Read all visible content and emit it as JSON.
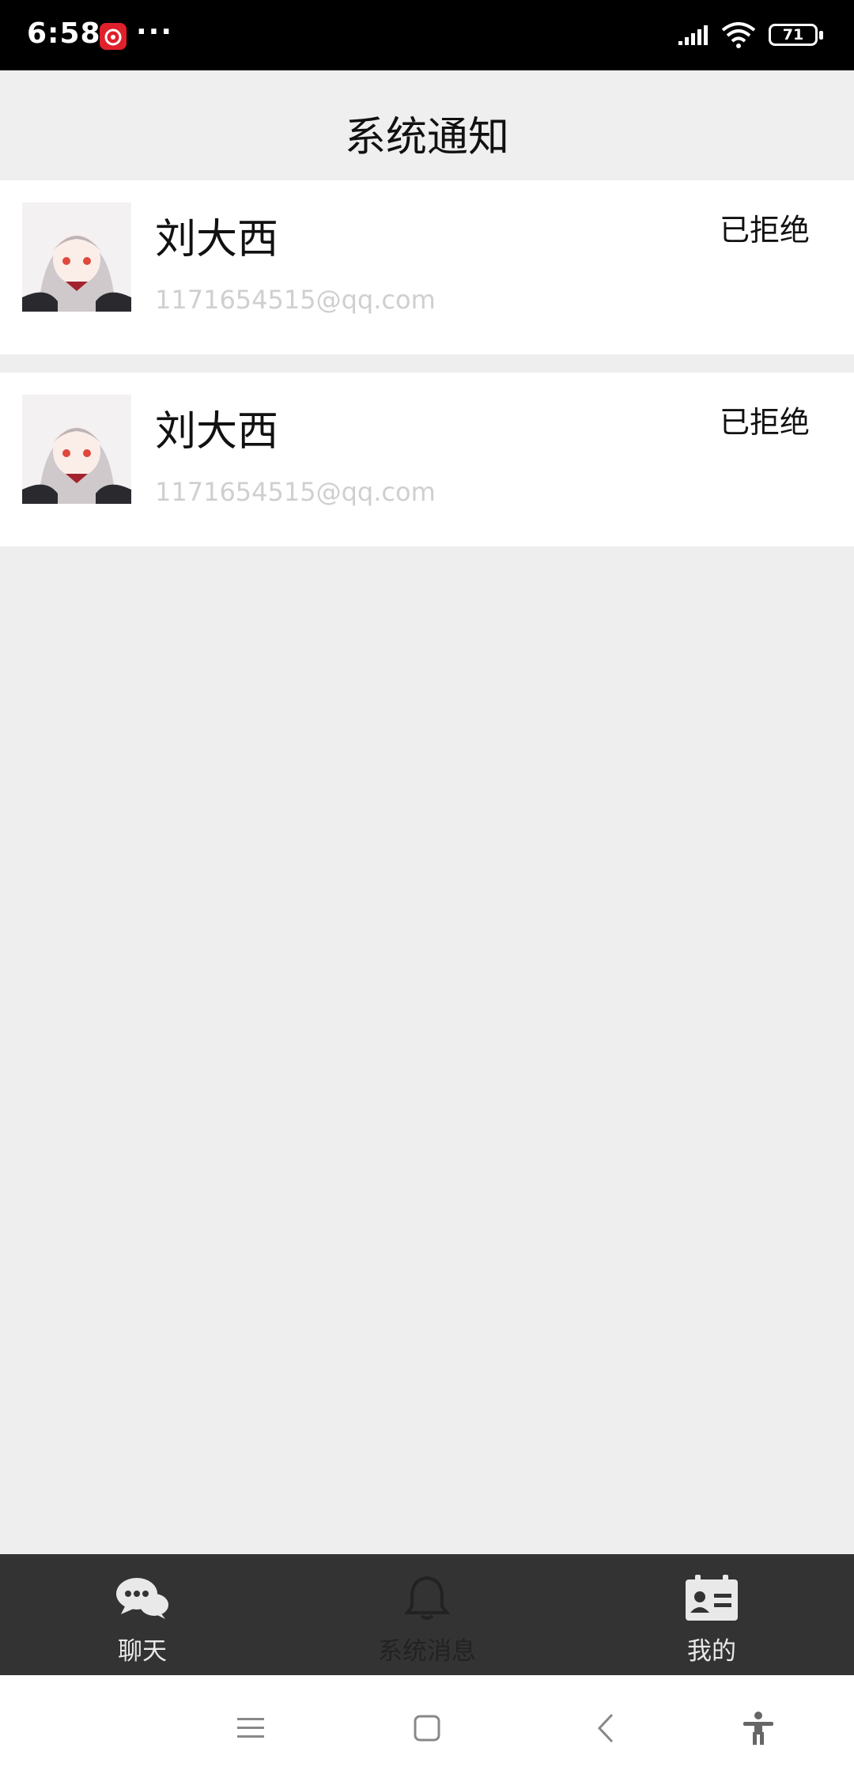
{
  "status_bar": {
    "time": "6:58",
    "more": "···",
    "battery": "71"
  },
  "header": {
    "title": "系统通知"
  },
  "notifications": [
    {
      "name": "刘大西",
      "email": "1171654515@qq.com",
      "status": "已拒绝"
    },
    {
      "name": "刘大西",
      "email": "1171654515@qq.com",
      "status": "已拒绝"
    }
  ],
  "tabbar": {
    "tabs": [
      {
        "label": "聊天",
        "icon": "chat-icon"
      },
      {
        "label": "系统消息",
        "icon": "bell-icon"
      },
      {
        "label": "我的",
        "icon": "contact-card-icon"
      }
    ]
  },
  "navbar": {
    "buttons": [
      "menu-icon",
      "home-icon",
      "back-icon",
      "accessibility-icon"
    ]
  }
}
